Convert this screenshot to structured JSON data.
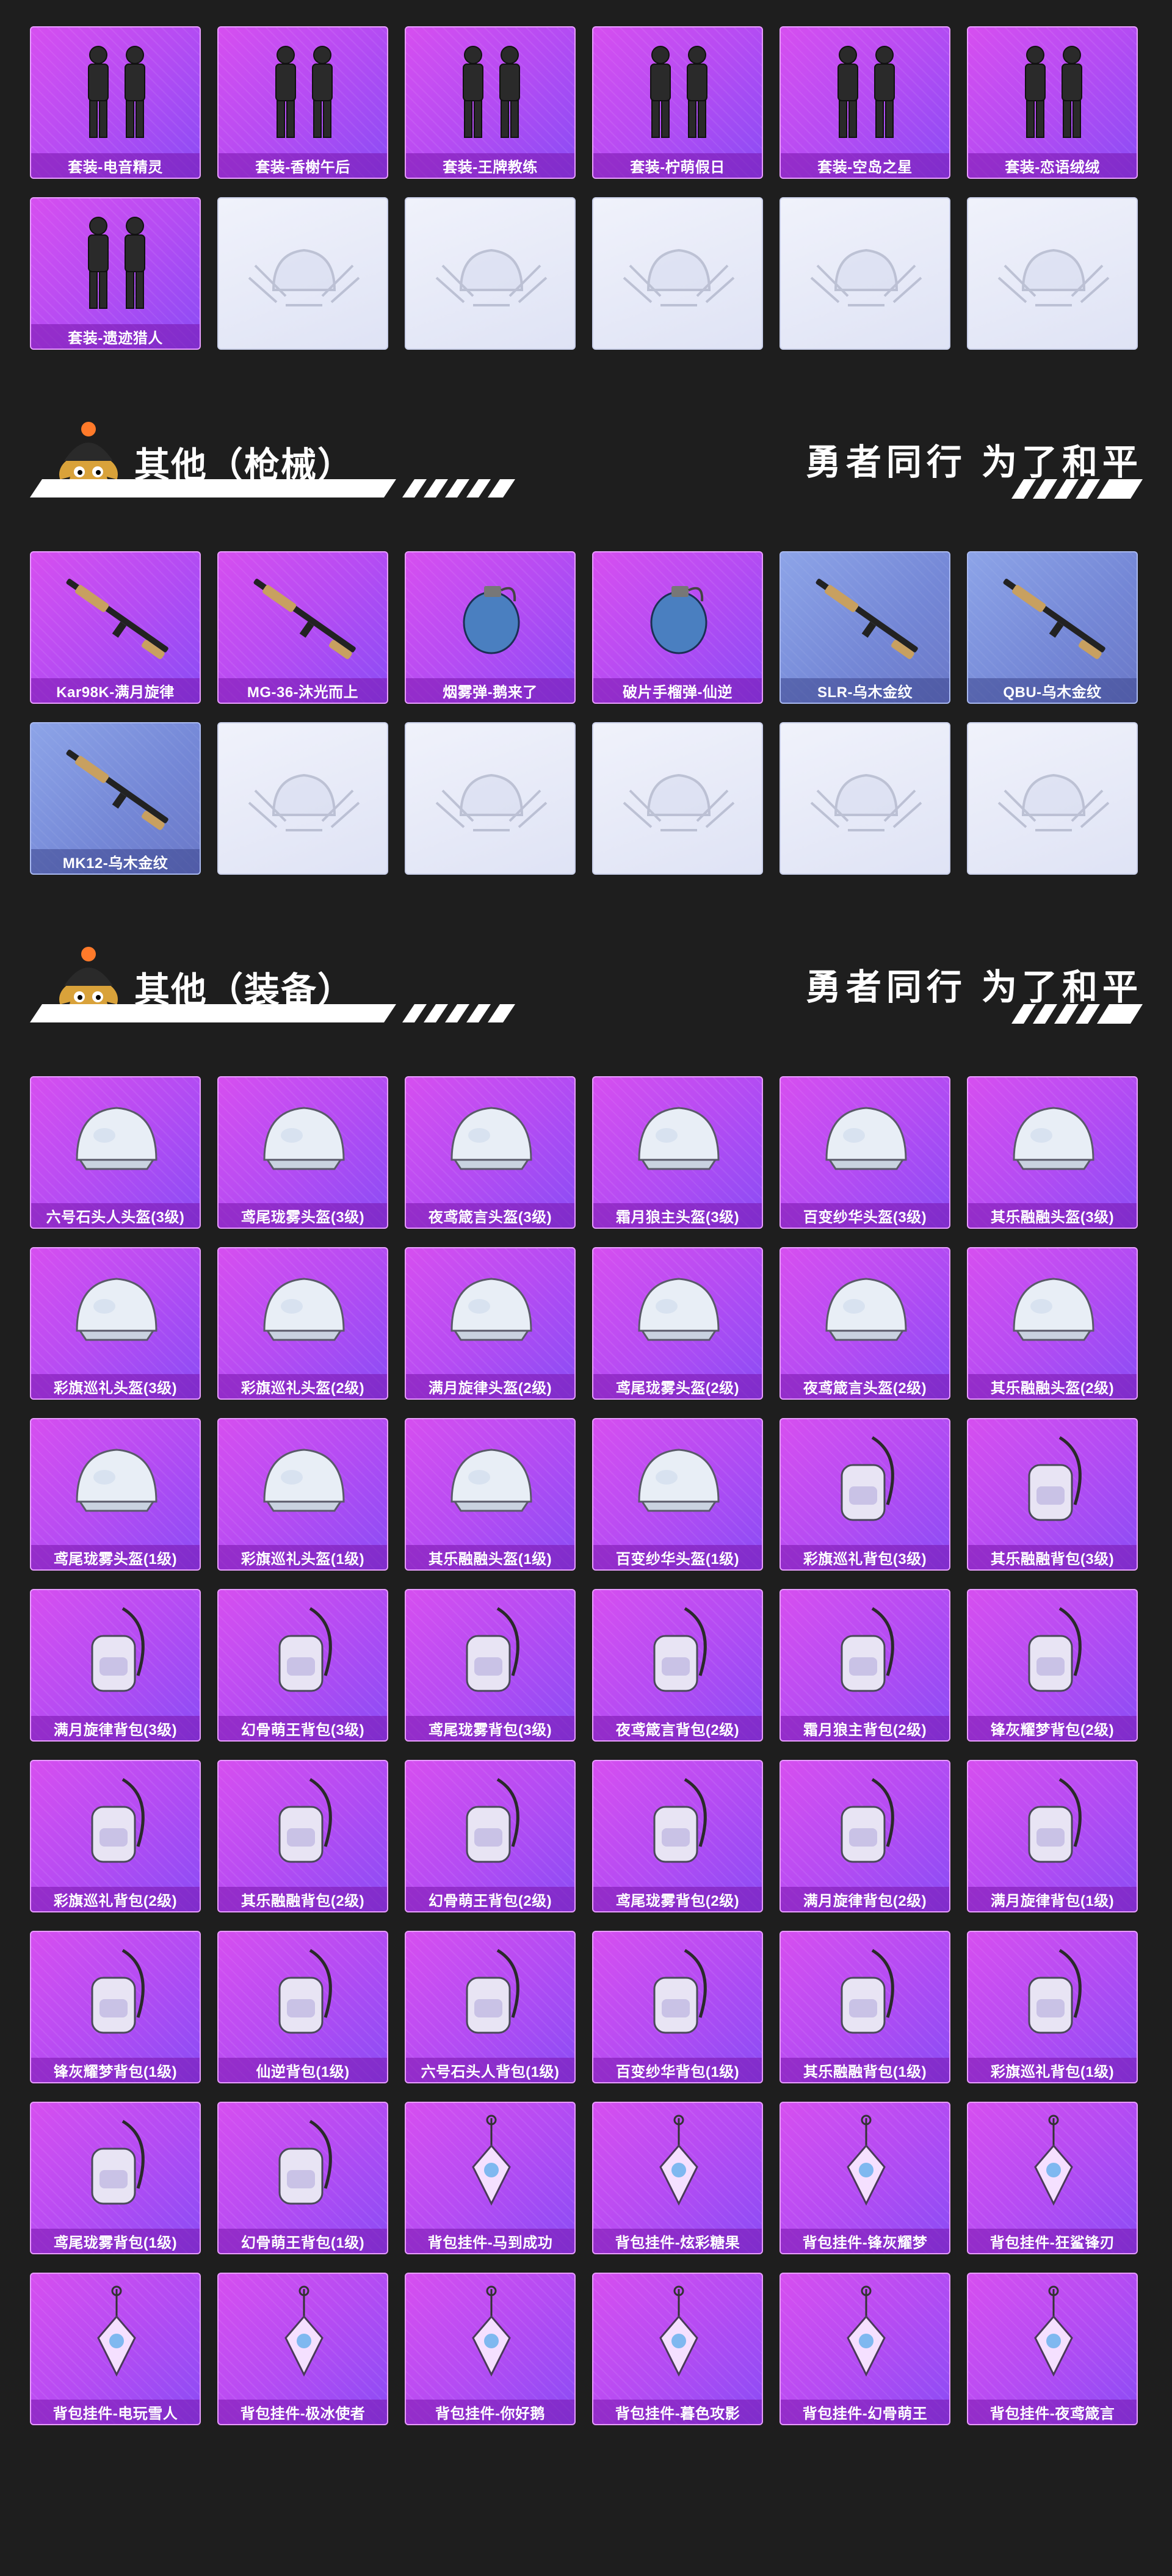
{
  "colors": {
    "background": "#1e1e1e",
    "card_purple": "#b54cf3",
    "card_blue": "#7487d6",
    "card_empty": "#e6e9f7"
  },
  "grids": [
    {
      "id": "outfits",
      "items": [
        {
          "label": "套装-电音精灵",
          "tier": "purple",
          "icon": "outfit-icon"
        },
        {
          "label": "套装-香榭午后",
          "tier": "purple",
          "icon": "outfit-icon"
        },
        {
          "label": "套装-王牌教练",
          "tier": "purple",
          "icon": "outfit-icon"
        },
        {
          "label": "套装-柠萌假日",
          "tier": "purple",
          "icon": "outfit-icon"
        },
        {
          "label": "套装-空岛之星",
          "tier": "purple",
          "icon": "outfit-icon"
        },
        {
          "label": "套装-恋语绒绒",
          "tier": "purple",
          "icon": "outfit-icon"
        },
        {
          "label": "套装-遗迹猎人",
          "tier": "purple",
          "icon": "outfit-icon"
        },
        {
          "label": "",
          "tier": "empty",
          "icon": "placeholder-emblem-icon"
        },
        {
          "label": "",
          "tier": "empty",
          "icon": "placeholder-emblem-icon"
        },
        {
          "label": "",
          "tier": "empty",
          "icon": "placeholder-emblem-icon"
        },
        {
          "label": "",
          "tier": "empty",
          "icon": "placeholder-emblem-icon"
        },
        {
          "label": "",
          "tier": "empty",
          "icon": "placeholder-emblem-icon"
        }
      ]
    },
    {
      "id": "weapons",
      "items": [
        {
          "label": "Kar98K-满月旋律",
          "tier": "purple",
          "icon": "rifle-icon"
        },
        {
          "label": "MG-36-沐光而上",
          "tier": "purple",
          "icon": "rifle-icon"
        },
        {
          "label": "烟雾弹-鹅来了",
          "tier": "purple",
          "icon": "grenade-icon"
        },
        {
          "label": "破片手榴弹-仙逆",
          "tier": "purple",
          "icon": "grenade-icon"
        },
        {
          "label": "SLR-乌木金纹",
          "tier": "blue",
          "icon": "rifle-icon"
        },
        {
          "label": "QBU-乌木金纹",
          "tier": "blue",
          "icon": "rifle-icon"
        },
        {
          "label": "MK12-乌木金纹",
          "tier": "blue",
          "icon": "rifle-icon"
        },
        {
          "label": "",
          "tier": "empty",
          "icon": "placeholder-emblem-icon"
        },
        {
          "label": "",
          "tier": "empty",
          "icon": "placeholder-emblem-icon"
        },
        {
          "label": "",
          "tier": "empty",
          "icon": "placeholder-emblem-icon"
        },
        {
          "label": "",
          "tier": "empty",
          "icon": "placeholder-emblem-icon"
        },
        {
          "label": "",
          "tier": "empty",
          "icon": "placeholder-emblem-icon"
        }
      ]
    },
    {
      "id": "equipment",
      "items": [
        {
          "label": "六号石头人头盔(3级)",
          "tier": "purple",
          "icon": "helmet-icon"
        },
        {
          "label": "鸢尾珑雾头盔(3级)",
          "tier": "purple",
          "icon": "helmet-icon"
        },
        {
          "label": "夜鸢箴言头盔(3级)",
          "tier": "purple",
          "icon": "helmet-icon"
        },
        {
          "label": "霜月狼主头盔(3级)",
          "tier": "purple",
          "icon": "helmet-icon"
        },
        {
          "label": "百变纱华头盔(3级)",
          "tier": "purple",
          "icon": "helmet-icon"
        },
        {
          "label": "其乐融融头盔(3级)",
          "tier": "purple",
          "icon": "helmet-icon"
        },
        {
          "label": "彩旗巡礼头盔(3级)",
          "tier": "purple",
          "icon": "helmet-icon"
        },
        {
          "label": "彩旗巡礼头盔(2级)",
          "tier": "purple",
          "icon": "helmet-icon"
        },
        {
          "label": "满月旋律头盔(2级)",
          "tier": "purple",
          "icon": "helmet-icon"
        },
        {
          "label": "鸢尾珑雾头盔(2级)",
          "tier": "purple",
          "icon": "helmet-icon"
        },
        {
          "label": "夜鸢箴言头盔(2级)",
          "tier": "purple",
          "icon": "helmet-icon"
        },
        {
          "label": "其乐融融头盔(2级)",
          "tier": "purple",
          "icon": "helmet-icon"
        },
        {
          "label": "鸢尾珑雾头盔(1级)",
          "tier": "purple",
          "icon": "helmet-icon"
        },
        {
          "label": "彩旗巡礼头盔(1级)",
          "tier": "purple",
          "icon": "helmet-icon"
        },
        {
          "label": "其乐融融头盔(1级)",
          "tier": "purple",
          "icon": "helmet-icon"
        },
        {
          "label": "百变纱华头盔(1级)",
          "tier": "purple",
          "icon": "helmet-icon"
        },
        {
          "label": "彩旗巡礼背包(3级)",
          "tier": "purple",
          "icon": "backpack-icon"
        },
        {
          "label": "其乐融融背包(3级)",
          "tier": "purple",
          "icon": "backpack-icon"
        },
        {
          "label": "满月旋律背包(3级)",
          "tier": "purple",
          "icon": "backpack-icon"
        },
        {
          "label": "幻骨萌王背包(3级)",
          "tier": "purple",
          "icon": "backpack-icon"
        },
        {
          "label": "鸢尾珑雾背包(3级)",
          "tier": "purple",
          "icon": "backpack-icon"
        },
        {
          "label": "夜鸢箴言背包(2级)",
          "tier": "purple",
          "icon": "backpack-icon"
        },
        {
          "label": "霜月狼主背包(2级)",
          "tier": "purple",
          "icon": "backpack-icon"
        },
        {
          "label": "锋灰耀梦背包(2级)",
          "tier": "purple",
          "icon": "backpack-icon"
        },
        {
          "label": "彩旗巡礼背包(2级)",
          "tier": "purple",
          "icon": "backpack-icon"
        },
        {
          "label": "其乐融融背包(2级)",
          "tier": "purple",
          "icon": "backpack-icon"
        },
        {
          "label": "幻骨萌王背包(2级)",
          "tier": "purple",
          "icon": "backpack-icon"
        },
        {
          "label": "鸢尾珑雾背包(2级)",
          "tier": "purple",
          "icon": "backpack-icon"
        },
        {
          "label": "满月旋律背包(2级)",
          "tier": "purple",
          "icon": "backpack-icon"
        },
        {
          "label": "满月旋律背包(1级)",
          "tier": "purple",
          "icon": "backpack-icon"
        },
        {
          "label": "锋灰耀梦背包(1级)",
          "tier": "purple",
          "icon": "backpack-icon"
        },
        {
          "label": "仙逆背包(1级)",
          "tier": "purple",
          "icon": "backpack-icon"
        },
        {
          "label": "六号石头人背包(1级)",
          "tier": "purple",
          "icon": "backpack-icon"
        },
        {
          "label": "百变纱华背包(1级)",
          "tier": "purple",
          "icon": "backpack-icon"
        },
        {
          "label": "其乐融融背包(1级)",
          "tier": "purple",
          "icon": "backpack-icon"
        },
        {
          "label": "彩旗巡礼背包(1级)",
          "tier": "purple",
          "icon": "backpack-icon"
        },
        {
          "label": "鸢尾珑雾背包(1级)",
          "tier": "purple",
          "icon": "backpack-icon"
        },
        {
          "label": "幻骨萌王背包(1级)",
          "tier": "purple",
          "icon": "backpack-icon"
        },
        {
          "label": "背包挂件-马到成功",
          "tier": "purple",
          "icon": "charm-icon"
        },
        {
          "label": "背包挂件-炫彩糖果",
          "tier": "purple",
          "icon": "charm-icon"
        },
        {
          "label": "背包挂件-锋灰耀梦",
          "tier": "purple",
          "icon": "charm-icon"
        },
        {
          "label": "背包挂件-狂鲨锋刃",
          "tier": "purple",
          "icon": "charm-icon"
        },
        {
          "label": "背包挂件-电玩雪人",
          "tier": "purple",
          "icon": "charm-icon"
        },
        {
          "label": "背包挂件-极冰使者",
          "tier": "purple",
          "icon": "charm-icon"
        },
        {
          "label": "背包挂件-你好鹅",
          "tier": "purple",
          "icon": "charm-icon"
        },
        {
          "label": "背包挂件-暮色攻影",
          "tier": "purple",
          "icon": "charm-icon"
        },
        {
          "label": "背包挂件-幻骨萌王",
          "tier": "purple",
          "icon": "charm-icon"
        },
        {
          "label": "背包挂件-夜鸢箴言",
          "tier": "purple",
          "icon": "charm-icon"
        }
      ]
    }
  ],
  "sections": [
    {
      "title": "其他（枪械）",
      "slogan": "勇者同行 为了和平",
      "icon": "mascot-icon"
    },
    {
      "title": "其他（装备）",
      "slogan": "勇者同行 为了和平",
      "icon": "mascot-icon"
    }
  ]
}
